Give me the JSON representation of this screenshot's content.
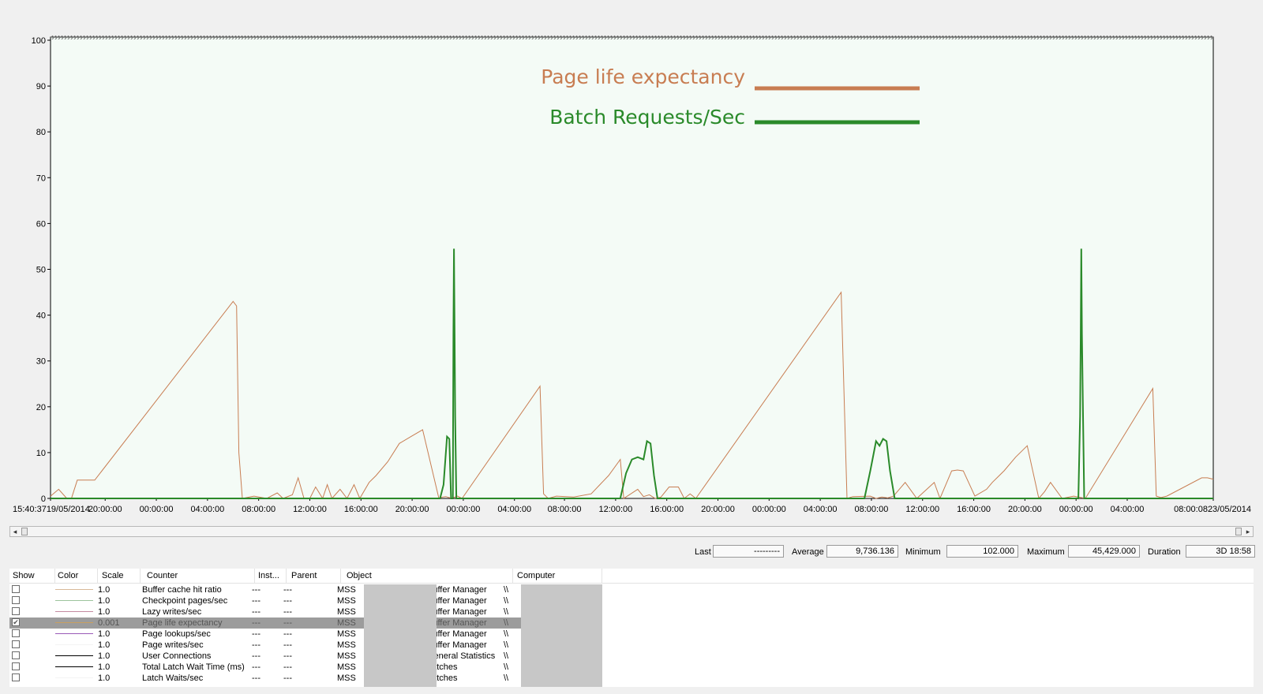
{
  "chart_data": {
    "type": "line",
    "ylim": [
      0,
      100
    ],
    "yticks": [
      0,
      10,
      20,
      30,
      40,
      50,
      60,
      70,
      80,
      90,
      100
    ],
    "xlim": [
      0,
      100
    ],
    "xtick_labels": [
      "15:40:3719/05/2014",
      "20:00:00",
      "00:00:00",
      "04:00:00",
      "08:00:00",
      "12:00:00",
      "16:00:00",
      "20:00:00",
      "00:00:00",
      "04:00:00",
      "08:00:00",
      "12:00:00",
      "16:00:00",
      "20:00:00",
      "00:00:00",
      "04:00:00",
      "08:00:00",
      "12:00:00",
      "16:00:00",
      "20:00:00",
      "00:00:00",
      "04:00:00",
      "08:00:0823/05/2014"
    ],
    "xtick_positions": [
      0,
      4.7,
      9.1,
      13.5,
      17.9,
      22.3,
      26.7,
      31.1,
      35.5,
      39.9,
      44.2,
      48.6,
      53.0,
      57.4,
      61.8,
      66.2,
      70.6,
      75.0,
      79.4,
      83.8,
      88.2,
      92.6,
      100
    ],
    "grid": false,
    "legend_position": "top-center",
    "series": [
      {
        "name": "Page life expectancy",
        "color": "#c87d52",
        "x": [
          0,
          0.7,
          1.4,
          1.8,
          2.3,
          3.8,
          15.7,
          16.0,
          16.2,
          16.5,
          17.5,
          18.6,
          19.5,
          20.0,
          20.8,
          21.3,
          21.8,
          22.3,
          22.8,
          23.4,
          23.8,
          24.2,
          24.9,
          25.5,
          26.1,
          26.6,
          27.4,
          28.0,
          29.0,
          30.0,
          31.0,
          32.0,
          33.4,
          33.7,
          34.0,
          34.5,
          35.0,
          35.4,
          42.1,
          42.4,
          42.8,
          43.5,
          45.0,
          46.5,
          48.0,
          49.0,
          49.3,
          50.5,
          51.0,
          51.5,
          52.0,
          52.5,
          53.2,
          54.0,
          54.5,
          55.0,
          55.5,
          68.0,
          68.5,
          69.0,
          70.5,
          71.0,
          71.5,
          72.0,
          72.5,
          73.5,
          74.5,
          76.0,
          76.5,
          77.0,
          77.5,
          78.0,
          78.5,
          79.5,
          80.5,
          81.0,
          82.0,
          83.0,
          84.0,
          85.0,
          85.5,
          86.0,
          87.0,
          88.0,
          89.0,
          94.8,
          95.1,
          95.5,
          96.0,
          99.0,
          99.5,
          100
        ],
        "values": [
          0.5,
          2,
          0,
          0,
          4,
          4,
          43,
          42,
          10,
          0,
          0.5,
          0,
          1.2,
          0,
          0.8,
          4.5,
          0,
          0,
          2.5,
          0,
          3,
          0,
          2,
          0,
          3,
          0,
          3.5,
          5,
          8,
          12,
          13.5,
          15,
          0,
          0.3,
          0.4,
          0,
          0.5,
          0,
          24.5,
          1,
          0,
          0.5,
          0.3,
          1,
          5,
          8.5,
          0,
          2,
          0.4,
          0.8,
          0,
          0.3,
          2.5,
          2.5,
          0,
          1,
          0,
          45,
          0,
          0.4,
          0.5,
          0,
          0.3,
          0.1,
          0.5,
          3.5,
          0,
          3.5,
          0,
          3,
          6,
          6.2,
          6,
          0.5,
          2,
          3.5,
          6,
          9,
          11.5,
          0,
          1.5,
          3.5,
          0,
          0.5,
          0,
          24,
          0.5,
          0.2,
          0.5,
          4.5,
          4.5,
          4.2
        ]
      },
      {
        "name": "Batch Requests/Sec",
        "color": "#2a8a2a",
        "x": [
          0,
          33.5,
          33.8,
          34.1,
          34.3,
          34.45,
          34.6,
          34.65,
          34.7,
          34.75,
          34.8,
          34.9,
          35.0,
          35.5,
          49.0,
          49.5,
          50.0,
          50.5,
          51.0,
          51.3,
          51.6,
          51.9,
          52.2,
          52.6,
          70.0,
          70.5,
          71.0,
          71.3,
          71.6,
          71.9,
          72.2,
          72.6,
          73.0,
          88.4,
          88.55,
          88.6,
          88.65,
          88.7,
          88.8,
          88.9,
          89.0,
          100
        ],
        "values": [
          0,
          0,
          3,
          13.5,
          13,
          0,
          0,
          36,
          54.5,
          36,
          18,
          0,
          0,
          0,
          0,
          5.5,
          8.5,
          9,
          8.5,
          12.5,
          12,
          5,
          0,
          0,
          0,
          6,
          12.5,
          11.5,
          13,
          12.5,
          6,
          0,
          0,
          0,
          18,
          36,
          54.5,
          36,
          18,
          0,
          0,
          0
        ]
      }
    ]
  },
  "scrollbar": {
    "left_arrow": "◂",
    "right_arrow": "▸"
  },
  "stats": {
    "last_label": "Last",
    "last_value": "---------",
    "average_label": "Average",
    "average_value": "9,736.136",
    "minimum_label": "Minimum",
    "minimum_value": "102.000",
    "maximum_label": "Maximum",
    "maximum_value": "45,429.000",
    "duration_label": "Duration",
    "duration_value": "3D 18:58"
  },
  "grid": {
    "headers": [
      "Show",
      "Color",
      "Scale",
      "Counter",
      "Inst...",
      "Parent",
      "Object",
      "Computer"
    ],
    "rows": [
      {
        "checked": false,
        "color": "#d8b898",
        "scale": "1.0",
        "counter": "Buffer cache hit ratio",
        "inst": "---",
        "parent": "---",
        "obj_prefix": "MSS",
        "object": "Buffer Manager",
        "computer": "\\\\",
        "selected": false
      },
      {
        "checked": false,
        "color": "#9cc49c",
        "scale": "1.0",
        "counter": "Checkpoint pages/sec",
        "inst": "---",
        "parent": "---",
        "obj_prefix": "MSS",
        "object": "Buffer Manager",
        "computer": "\\\\",
        "selected": false
      },
      {
        "checked": false,
        "color": "#c48aa0",
        "scale": "1.0",
        "counter": "Lazy writes/sec",
        "inst": "---",
        "parent": "---",
        "obj_prefix": "MSS",
        "object": "Buffer Manager",
        "computer": "\\\\",
        "selected": false
      },
      {
        "checked": true,
        "color": "#c8a060",
        "scale": "0.001",
        "counter": "Page life expectancy",
        "inst": "---",
        "parent": "---",
        "obj_prefix": "MSS",
        "object": "Buffer Manager",
        "computer": "\\\\",
        "selected": true
      },
      {
        "checked": false,
        "color": "#9a5ab8",
        "scale": "1.0",
        "counter": "Page lookups/sec",
        "inst": "---",
        "parent": "---",
        "obj_prefix": "MSS",
        "object": "Buffer Manager",
        "computer": "\\\\",
        "selected": false
      },
      {
        "checked": false,
        "color": "#f4f4f4",
        "scale": "1.0",
        "counter": "Page writes/sec",
        "inst": "---",
        "parent": "---",
        "obj_prefix": "MSS",
        "object": "Buffer Manager",
        "computer": "\\\\",
        "selected": false
      },
      {
        "checked": false,
        "color": "#000000",
        "scale": "1.0",
        "counter": "User Connections",
        "inst": "---",
        "parent": "---",
        "obj_prefix": "MSS",
        "object": "General Statistics",
        "computer": "\\\\",
        "selected": false
      },
      {
        "checked": false,
        "color": "#000000",
        "scale": "1.0",
        "counter": "Total Latch Wait Time (ms)",
        "inst": "---",
        "parent": "---",
        "obj_prefix": "MSS",
        "object": "Latches",
        "computer": "\\\\",
        "selected": false
      },
      {
        "checked": false,
        "color": "#f4f4f4",
        "scale": "1.0",
        "counter": "Latch Waits/sec",
        "inst": "---",
        "parent": "---",
        "obj_prefix": "MSS",
        "object": "Latches",
        "computer": "\\\\",
        "selected": false
      }
    ]
  }
}
